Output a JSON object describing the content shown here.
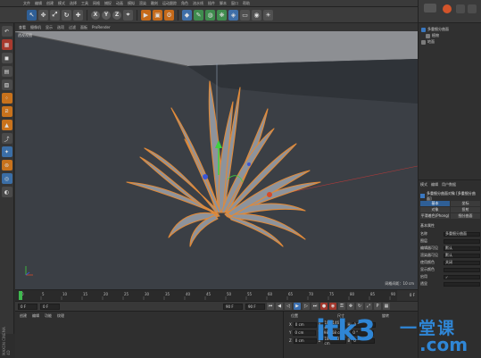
{
  "menubar": {
    "items": [
      "文件",
      "编辑",
      "创建",
      "模式",
      "选择",
      "工具",
      "网格",
      "捕捉",
      "动画",
      "模拟",
      "渲染",
      "雕刻",
      "运动跟踪",
      "角色",
      "流水线",
      "插件",
      "脚本",
      "窗口",
      "帮助"
    ]
  },
  "toolbar": {
    "x_label": "X",
    "y_label": "Y",
    "z_label": "Z"
  },
  "viewport": {
    "menu": [
      "查看",
      "摄像机",
      "显示",
      "选项",
      "过滤",
      "面板",
      "ProRender"
    ],
    "label": "透视视图",
    "grid_spacing": "网格间距：10 cm"
  },
  "timeline": {
    "ticks": [
      "0",
      "5",
      "10",
      "15",
      "20",
      "25",
      "30",
      "35",
      "40",
      "45",
      "50",
      "55",
      "60",
      "65",
      "70",
      "75",
      "80",
      "85",
      "90"
    ],
    "end_frame": "0 F"
  },
  "transport": {
    "start_field": "0 F",
    "current_field": "0 F",
    "end_field": "90 F",
    "max_field": "90 F"
  },
  "material_manager": {
    "menu": [
      "创建",
      "编辑",
      "功能",
      "纹理"
    ],
    "brand": "MAXON CINEMA 4D"
  },
  "coordinates": {
    "headers": [
      "位置",
      "尺寸",
      "旋转"
    ],
    "rows": [
      {
        "axis": "X",
        "pos": "0 cm",
        "size": "185.146 cm",
        "rot_label": "H",
        "rot": "0 °"
      },
      {
        "axis": "Y",
        "pos": "0 cm",
        "size": "98.468 cm",
        "rot_label": "P",
        "rot": "0 °"
      },
      {
        "axis": "Z",
        "pos": "0 cm",
        "size": "184.833 cm",
        "rot_label": "B",
        "rot": "0 °"
      }
    ]
  },
  "object_manager": {
    "items": [
      {
        "label": "多重细分曲面",
        "color": "#3a78c0"
      },
      {
        "label": "植物",
        "color": "#7c7c7c"
      },
      {
        "label": "地面",
        "color": "#7c7c7c"
      }
    ]
  },
  "attribute_manager": {
    "tabs": [
      "模式",
      "编辑",
      "用户数据"
    ],
    "object_title": "多重细分曲面对象 [多重细分曲面]",
    "buttons": [
      "基本",
      "坐标",
      "对象",
      "投射",
      "平滑着色(Phong)",
      "细分曲面"
    ],
    "section": "基本属性",
    "fields": [
      {
        "label": "名称",
        "value": "多重细分曲面"
      },
      {
        "label": "图层",
        "value": ""
      },
      {
        "label": "编辑器可见",
        "value": "默认"
      },
      {
        "label": "渲染器可见",
        "value": "默认"
      },
      {
        "label": "使用颜色",
        "value": "关闭"
      },
      {
        "label": "显示颜色",
        "value": ""
      },
      {
        "label": "启用",
        "value": "✓"
      },
      {
        "label": "透显",
        "value": ""
      }
    ]
  },
  "watermark": {
    "text": "itk3",
    "cn": "一堂课",
    "com": ".com"
  },
  "colors": {
    "accent_blue": "#2f86d6",
    "plant_outline": "#e08a3a",
    "plant_fill": "#8d939c",
    "ground": "#3a3e44",
    "selection_blue": "#2f5f96"
  },
  "icons": [
    "undo-icon",
    "move-icon",
    "scale-icon",
    "rotate-icon",
    "render-icon",
    "cube-icon",
    "pen-icon",
    "light-icon",
    "camera-icon"
  ]
}
